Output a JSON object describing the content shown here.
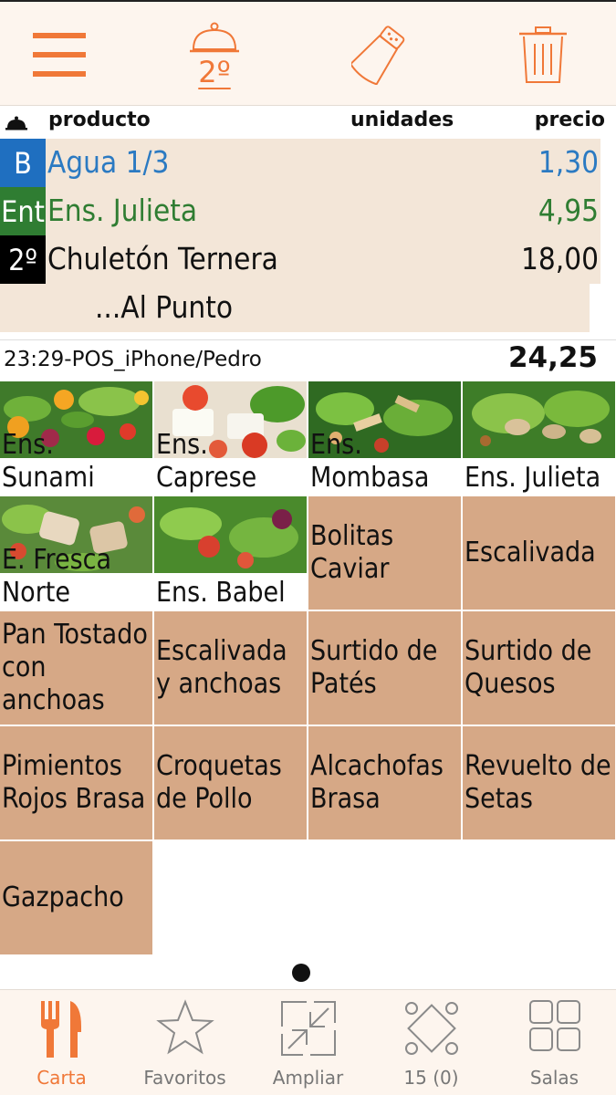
{
  "toolbar": {
    "menu_icon": "hamburger-menu-icon",
    "course_icon": "service-bell-icon",
    "course_label": "2º",
    "seasoning_icon": "salt-shaker-icon",
    "delete_icon": "trash-icon",
    "accent_color": "#f07838"
  },
  "order": {
    "header": {
      "icon": "service-bell-icon",
      "product": "producto",
      "units": "unidades",
      "price": "precio"
    },
    "lines": [
      {
        "badge": "B",
        "badge_color": "#1f6fc0",
        "name": "Agua 1/3",
        "price": "1,30",
        "color": "#2b7ac2"
      },
      {
        "badge": "Ent",
        "badge_color": "#2f7d32",
        "name": "Ens. Julieta",
        "price": "4,95",
        "color": "#2f7d32"
      },
      {
        "badge": "2º",
        "badge_color": "#000000",
        "name": "Chuletón Ternera",
        "price": "18,00",
        "color": "#111111"
      }
    ],
    "modifier": "...Al Punto",
    "info": "23:29-POS_iPhone/Pedro",
    "total": "24,25"
  },
  "products": [
    {
      "label": "Ens. Sunami",
      "kind": "image"
    },
    {
      "label": "Ens. Caprese",
      "kind": "image"
    },
    {
      "label": "Ens. Mombasa",
      "kind": "image"
    },
    {
      "label": "Ens. Julieta",
      "kind": "image"
    },
    {
      "label": "E. Fresca Norte",
      "kind": "image"
    },
    {
      "label": "Ens. Babel",
      "kind": "image"
    },
    {
      "label": "Bolitas Caviar",
      "kind": "text"
    },
    {
      "label": "Escalivada",
      "kind": "text"
    },
    {
      "label": "Pan Tostado con anchoas",
      "kind": "text"
    },
    {
      "label": "Escalivada y anchoas",
      "kind": "text"
    },
    {
      "label": "Surtido de Patés",
      "kind": "text"
    },
    {
      "label": "Surtido de Quesos",
      "kind": "text"
    },
    {
      "label": "Pimientos Rojos Brasa",
      "kind": "text"
    },
    {
      "label": "Croquetas de Pollo",
      "kind": "text"
    },
    {
      "label": "Alcachofas Brasa",
      "kind": "text"
    },
    {
      "label": "Revuelto de Setas",
      "kind": "text"
    },
    {
      "label": "Gazpacho",
      "kind": "text"
    }
  ],
  "tile_color": "#d6a886",
  "tabs": [
    {
      "label": "Carta",
      "icon": "fork-knife-icon",
      "active": true
    },
    {
      "label": "Favoritos",
      "icon": "star-icon",
      "active": false
    },
    {
      "label": "Ampliar",
      "icon": "expand-arrows-icon",
      "active": false
    },
    {
      "label": "15 (0)",
      "icon": "table-icon",
      "active": false
    },
    {
      "label": "Salas",
      "icon": "grid-icon",
      "active": false
    }
  ]
}
